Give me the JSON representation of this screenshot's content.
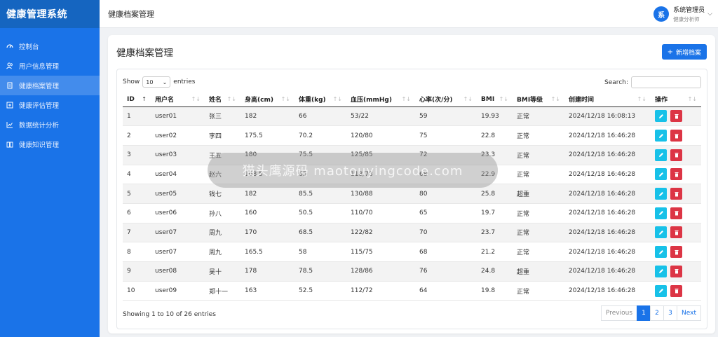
{
  "brand": "健康管理系统",
  "topbar": {
    "title": "健康档案管理"
  },
  "user": {
    "avatar_char": "系",
    "name": "系统管理员",
    "role": "健康分析师"
  },
  "sidebar": {
    "items": [
      {
        "label": "控制台",
        "icon": "dashboard-icon"
      },
      {
        "label": "用户信息管理",
        "icon": "users-icon"
      },
      {
        "label": "健康档案管理",
        "icon": "document-icon",
        "active": true
      },
      {
        "label": "健康评估管理",
        "icon": "plus-square-icon"
      },
      {
        "label": "数据统计分析",
        "icon": "chart-line-icon"
      },
      {
        "label": "健康知识管理",
        "icon": "book-icon"
      }
    ]
  },
  "main": {
    "heading": "健康档案管理",
    "add_label": "新增档案",
    "show_label": "Show",
    "entries_label": "entries",
    "page_size": "10",
    "search_label": "Search:",
    "columns": [
      "ID",
      "用户名",
      "姓名",
      "身高(cm)",
      "体重(kg)",
      "血压(mmHg)",
      "心率(次/分)",
      "BMI",
      "BMI等级",
      "创建时间",
      "操作"
    ],
    "rows": [
      [
        "1",
        "user01",
        "张三",
        "182",
        "66",
        "53/22",
        "59",
        "19.93",
        "正常",
        "2024/12/18 16:08:13"
      ],
      [
        "2",
        "user02",
        "李四",
        "175.5",
        "70.2",
        "120/80",
        "75",
        "22.8",
        "正常",
        "2024/12/18 16:46:28"
      ],
      [
        "3",
        "user03",
        "王五",
        "180",
        "75.5",
        "125/85",
        "72",
        "23.3",
        "正常",
        "2024/12/18 16:46:28"
      ],
      [
        "4",
        "user04",
        "赵六",
        "168.5",
        "65",
        "118/78",
        "68",
        "22.9",
        "正常",
        "2024/12/18 16:46:28"
      ],
      [
        "5",
        "user05",
        "钱七",
        "182",
        "85.5",
        "130/88",
        "80",
        "25.8",
        "超重",
        "2024/12/18 16:46:28"
      ],
      [
        "6",
        "user06",
        "孙八",
        "160",
        "50.5",
        "110/70",
        "65",
        "19.7",
        "正常",
        "2024/12/18 16:46:28"
      ],
      [
        "7",
        "user07",
        "周九",
        "170",
        "68.5",
        "122/82",
        "70",
        "23.7",
        "正常",
        "2024/12/18 16:46:28"
      ],
      [
        "8",
        "user07",
        "周九",
        "165.5",
        "58",
        "115/75",
        "68",
        "21.2",
        "正常",
        "2024/12/18 16:46:28"
      ],
      [
        "9",
        "user08",
        "吴十",
        "178",
        "78.5",
        "128/86",
        "76",
        "24.8",
        "超重",
        "2024/12/18 16:46:28"
      ],
      [
        "10",
        "user09",
        "郑十一",
        "163",
        "52.5",
        "112/72",
        "64",
        "19.8",
        "正常",
        "2024/12/18 16:46:28"
      ]
    ],
    "info": "Showing 1 to 10 of 26 entries",
    "pagination": {
      "previous": "Previous",
      "pages": [
        "1",
        "2",
        "3"
      ],
      "current": "1",
      "next": "Next"
    }
  },
  "watermark": "猫头鹰源码 maotouyingcode.com",
  "colors": {
    "primary": "#1a73e8",
    "edit": "#17c1e8",
    "delete": "#dc3545"
  }
}
